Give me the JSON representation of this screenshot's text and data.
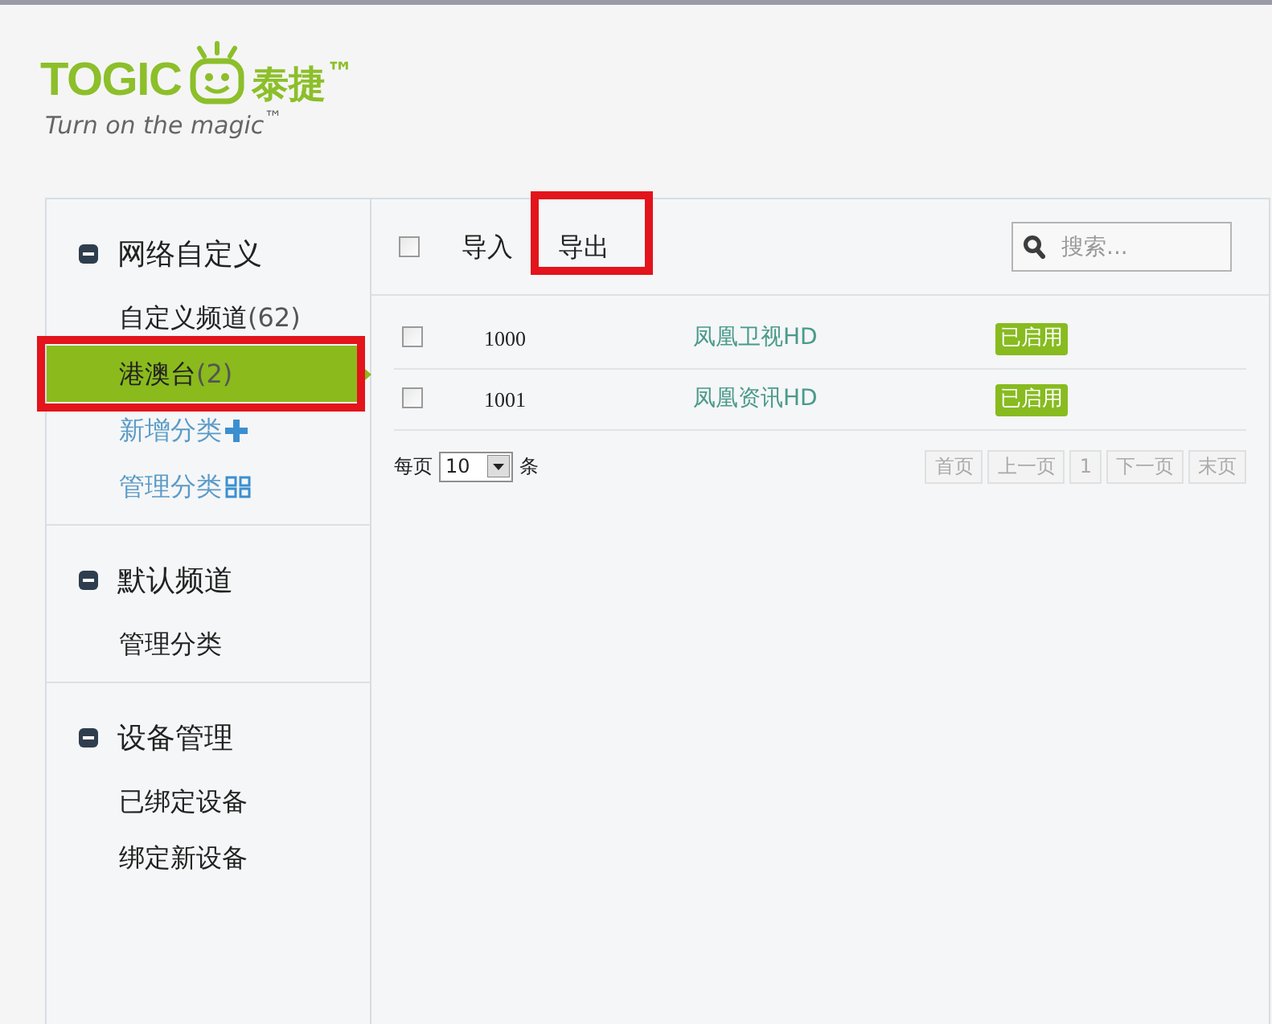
{
  "logo": {
    "brand": "TOGIC",
    "brand_cn": "泰捷$^{™}$",
    "tagline": "Turn on the magic$^{™}$"
  },
  "sidebar": {
    "groups": [
      {
        "title": "网络自定义",
        "expanded": true,
        "items": [
          {
            "kind": "item",
            "label": "自定义频道",
            "count": "(62)",
            "selected": false,
            "highlighted": false
          },
          {
            "kind": "item",
            "label": "港澳台",
            "count": "(2)",
            "selected": true,
            "highlighted": true
          },
          {
            "kind": "add",
            "label": "新增分类",
            "selected": false,
            "highlighted": false
          },
          {
            "kind": "manage",
            "label": "管理分类",
            "selected": false,
            "highlighted": false
          }
        ]
      },
      {
        "title": "默认频道",
        "expanded": true,
        "items": [
          {
            "kind": "item",
            "label": "管理分类",
            "selected": false,
            "highlighted": false
          }
        ]
      },
      {
        "title": "设备管理",
        "expanded": true,
        "items": [
          {
            "kind": "item",
            "label": "已绑定设备",
            "selected": false,
            "highlighted": false
          },
          {
            "kind": "item",
            "label": "绑定新设备",
            "selected": false,
            "highlighted": false
          }
        ]
      }
    ]
  },
  "toolbar": {
    "select_all": {
      "checked": false
    },
    "buttons": [
      {
        "label": "导入",
        "highlighted": false
      },
      {
        "label": "导出",
        "highlighted": true
      }
    ],
    "search": {
      "placeholder": "搜索..."
    }
  },
  "table": {
    "rows": [
      {
        "checked": false,
        "id": "1000",
        "name": "凤凰卫视HD",
        "status": "已启用"
      },
      {
        "checked": false,
        "id": "1001",
        "name": "凤凰资讯HD",
        "status": "已启用"
      }
    ]
  },
  "pager": {
    "per_page_label": "每页",
    "per_page": "10",
    "unit": "条",
    "buttons": [
      {
        "label": "首页"
      },
      {
        "label": "上一页"
      },
      {
        "label": "1"
      },
      {
        "label": "下一页"
      },
      {
        "label": "末页"
      }
    ]
  }
}
